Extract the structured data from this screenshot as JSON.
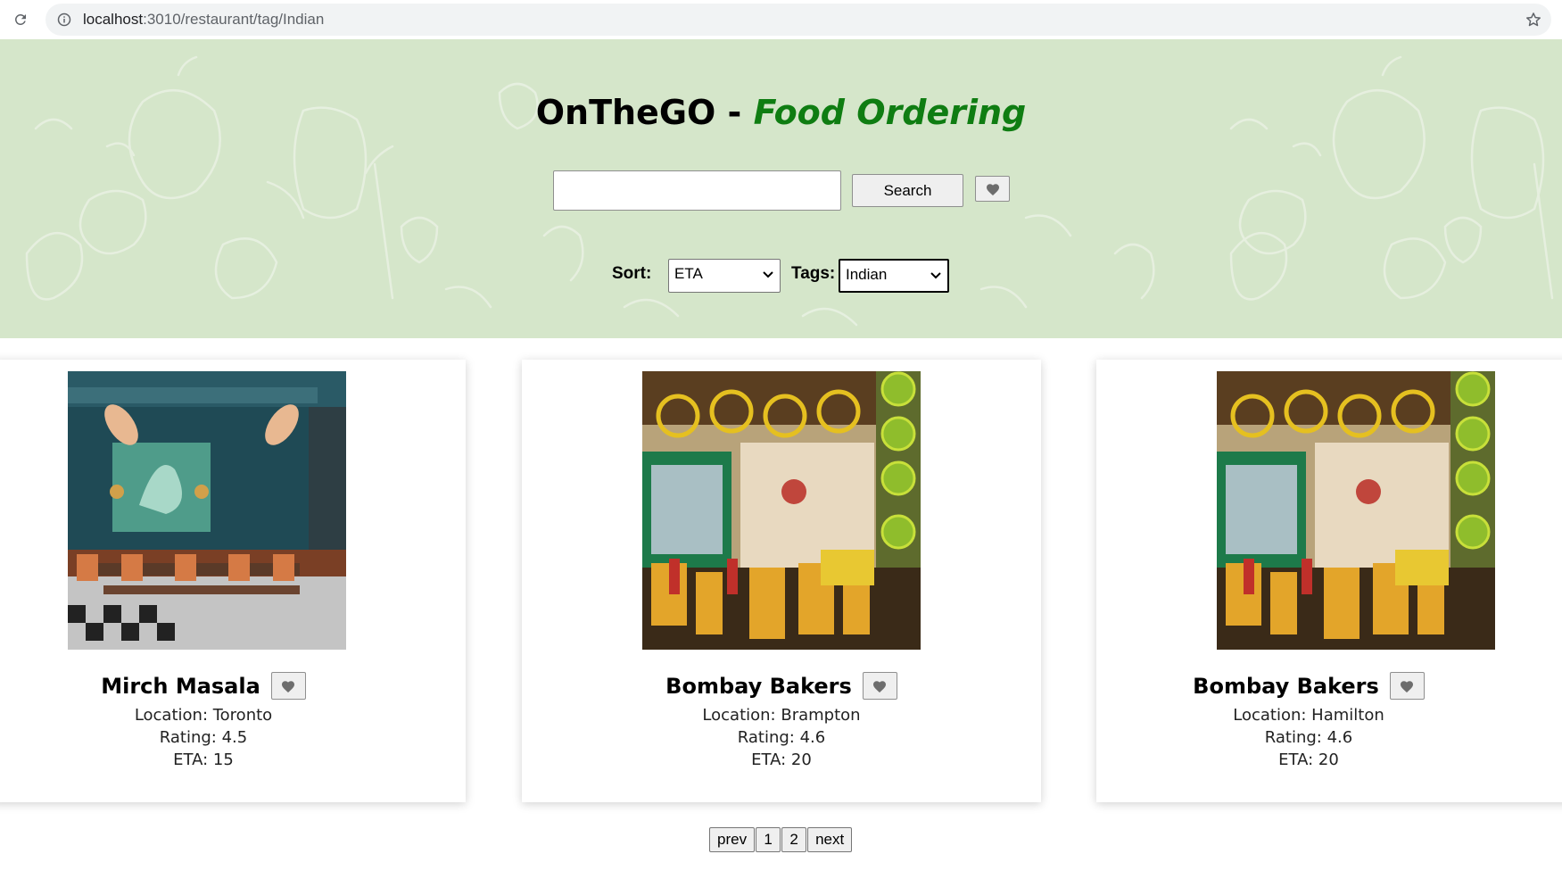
{
  "browser": {
    "url_host": "localhost",
    "url_path": ":3010/restaurant/tag/Indian"
  },
  "header": {
    "brand": "OnTheGO",
    "separator": " - ",
    "tagline": "Food Ordering",
    "search": {
      "value": "",
      "placeholder": "",
      "button_label": "Search"
    },
    "sort": {
      "label": "Sort:",
      "selected": "ETA"
    },
    "tags": {
      "label": "Tags:",
      "selected": "Indian"
    }
  },
  "restaurants": [
    {
      "name": "Mirch Masala",
      "location": "Location: Toronto",
      "rating": "Rating: 4.5",
      "eta": "ETA: 15"
    },
    {
      "name": "Bombay Bakers",
      "location": "Location: Brampton",
      "rating": "Rating: 4.6",
      "eta": "ETA: 20"
    },
    {
      "name": "Bombay Bakers",
      "location": "Location: Hamilton",
      "rating": "Rating: 4.6",
      "eta": "ETA: 20"
    }
  ],
  "pagination": {
    "prev": "prev",
    "pages": [
      "1",
      "2"
    ],
    "next": "next"
  },
  "colors": {
    "hero_bg": "#d5e6ca",
    "accent": "#0f7d12"
  },
  "icons": [
    "reload-icon",
    "info-icon",
    "star-icon",
    "heart-icon",
    "chevron-down-icon"
  ]
}
